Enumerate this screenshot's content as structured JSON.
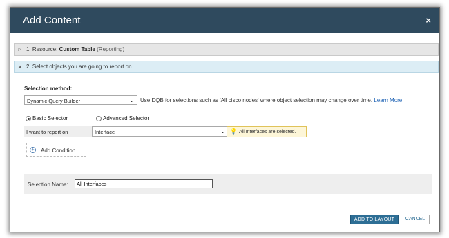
{
  "dialog": {
    "title": "Add Content",
    "close_glyph": "×"
  },
  "step1": {
    "number": "1. Resource:",
    "name": "Custom Table",
    "category": "(Reporting)"
  },
  "step2": {
    "label": "2. Select objects you are going to report on..."
  },
  "selection_method": {
    "label": "Selection method:",
    "value": "Dynamic Query Builder",
    "hint": "Use DQB for selections such as 'All cisco nodes' where object selection may change over time.",
    "learn_more": "Learn More"
  },
  "selector": {
    "basic": "Basic Selector",
    "advanced": "Advanced Selector",
    "selected": "basic"
  },
  "report_on": {
    "label": "I want to report on",
    "value": "Interface"
  },
  "info": {
    "message": "All Interfaces are selected."
  },
  "add_condition": {
    "label": "Add Condition"
  },
  "selection_name": {
    "label": "Selection Name:",
    "value": "All Interfaces"
  },
  "footer": {
    "add_label": "ADD TO LAYOUT",
    "cancel_label": "CANCEL"
  },
  "colors": {
    "titlebar": "#2f4a5e",
    "accent": "#2d6e95",
    "link": "#1f63b5",
    "info_bg": "#fdf6d8"
  }
}
